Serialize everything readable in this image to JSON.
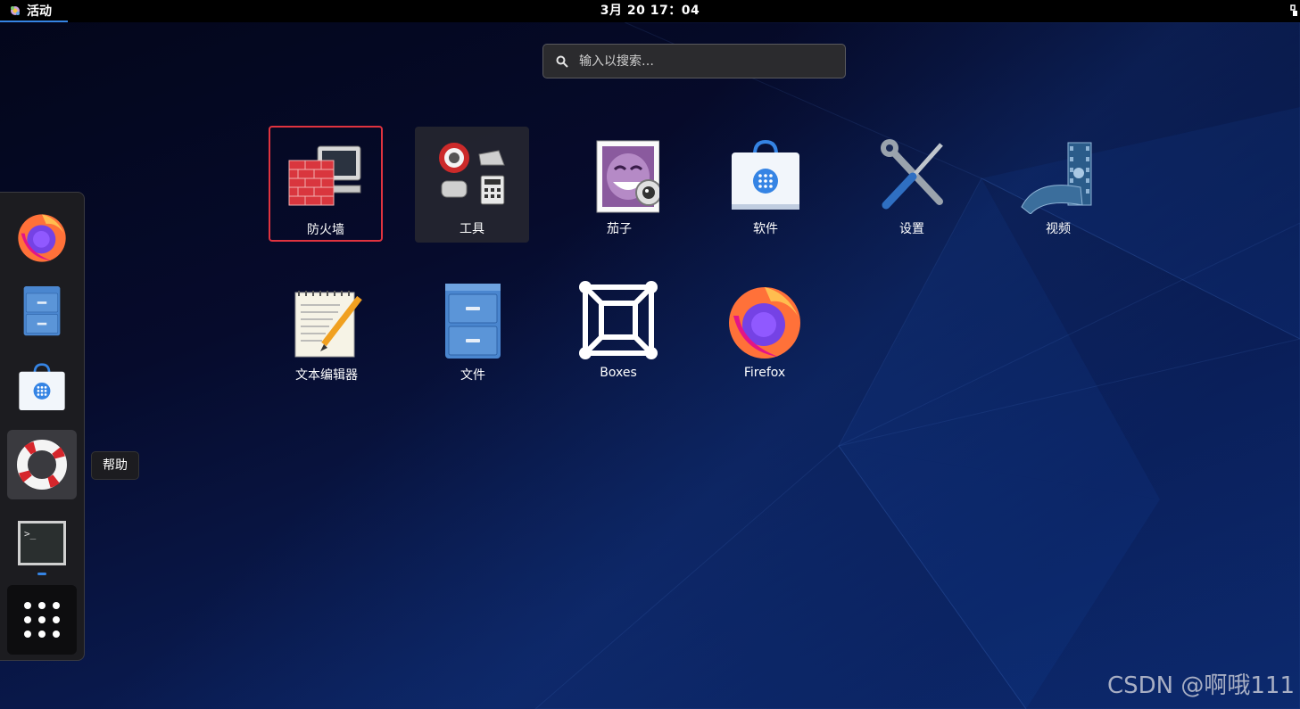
{
  "topbar": {
    "activities_label": "活动",
    "clock": "3月 20  17：04"
  },
  "search": {
    "placeholder": "输入以搜索…"
  },
  "apps": [
    {
      "label": "防火墙",
      "icon": "firewall-icon",
      "selected": true
    },
    {
      "label": "工具",
      "icon": "utilities-folder-icon"
    },
    {
      "label": "茄子",
      "icon": "cheese-icon"
    },
    {
      "label": "软件",
      "icon": "software-icon"
    },
    {
      "label": "设置",
      "icon": "settings-tools-icon"
    },
    {
      "label": "视频",
      "icon": "videos-icon"
    },
    {
      "label": "文本编辑器",
      "icon": "text-editor-icon"
    },
    {
      "label": "文件",
      "icon": "files-cabinet-icon"
    },
    {
      "label": "Boxes",
      "icon": "boxes-icon"
    },
    {
      "label": "Firefox",
      "icon": "firefox-icon"
    }
  ],
  "dash": {
    "items": [
      "firefox-icon",
      "files-cabinet-icon",
      "software-icon",
      "help-icon",
      "terminal-icon",
      "show-apps-icon"
    ],
    "tooltip": "帮助"
  },
  "watermark": "CSDN @啊哦111",
  "colors": {
    "accent": "#3584e4",
    "selection": "#e0333f",
    "topbar": "#000000"
  }
}
